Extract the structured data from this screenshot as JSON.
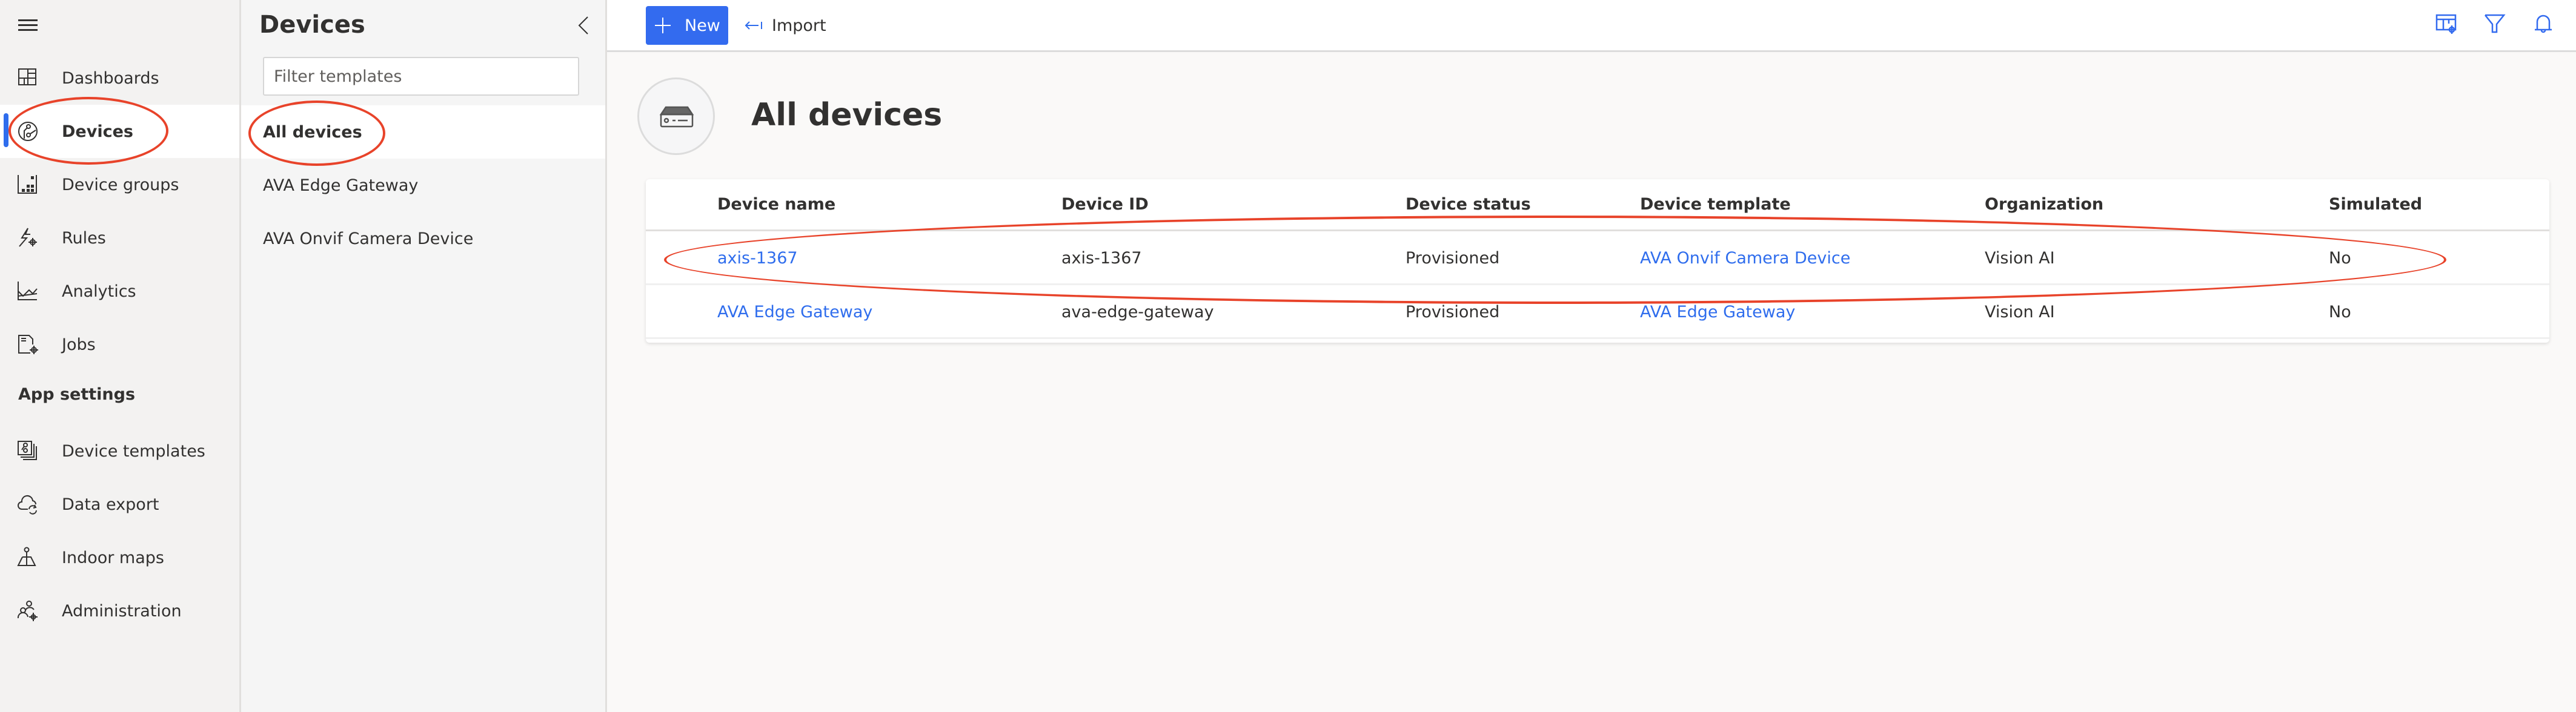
{
  "nav": {
    "menu_icon": "hamburger-icon",
    "items": [
      {
        "label": "Dashboards",
        "icon": "dashboard-icon",
        "active": false
      },
      {
        "label": "Devices",
        "icon": "devices-icon",
        "active": true
      },
      {
        "label": "Device groups",
        "icon": "device-groups-icon",
        "active": false
      },
      {
        "label": "Rules",
        "icon": "rules-icon",
        "active": false
      },
      {
        "label": "Analytics",
        "icon": "analytics-icon",
        "active": false
      },
      {
        "label": "Jobs",
        "icon": "jobs-icon",
        "active": false
      }
    ],
    "section_label": "App settings",
    "settings_items": [
      {
        "label": "Device templates",
        "icon": "device-templates-icon"
      },
      {
        "label": "Data export",
        "icon": "data-export-icon"
      },
      {
        "label": "Indoor maps",
        "icon": "indoor-maps-icon"
      },
      {
        "label": "Administration",
        "icon": "administration-icon"
      }
    ]
  },
  "templates_pane": {
    "title": "Devices",
    "collapse_icon": "chevron-left-icon",
    "filter_placeholder": "Filter templates",
    "filter_value": "",
    "items": [
      {
        "label": "All devices",
        "active": true
      },
      {
        "label": "AVA Edge Gateway",
        "active": false
      },
      {
        "label": "AVA Onvif Camera Device",
        "active": false
      }
    ]
  },
  "toolbar": {
    "new_label": "New",
    "import_label": "Import",
    "right_icons": [
      "table-settings-icon",
      "filter-icon",
      "bell-icon"
    ]
  },
  "main": {
    "title": "All devices",
    "hero_icon": "device-box-icon",
    "table": {
      "columns": [
        "Device name",
        "Device ID",
        "Device status",
        "Device template",
        "Organization",
        "Simulated"
      ],
      "rows": [
        {
          "name": "axis-1367",
          "id": "axis-1367",
          "status": "Provisioned",
          "template": "AVA Onvif Camera Device",
          "organization": "Vision AI",
          "simulated": "No"
        },
        {
          "name": "AVA Edge Gateway",
          "id": "ava-edge-gateway",
          "status": "Provisioned",
          "template": "AVA Edge Gateway",
          "organization": "Vision AI",
          "simulated": "No"
        }
      ]
    }
  },
  "colors": {
    "accent": "#336bef",
    "link": "#2f6ded",
    "annotation": "#e8432a"
  }
}
